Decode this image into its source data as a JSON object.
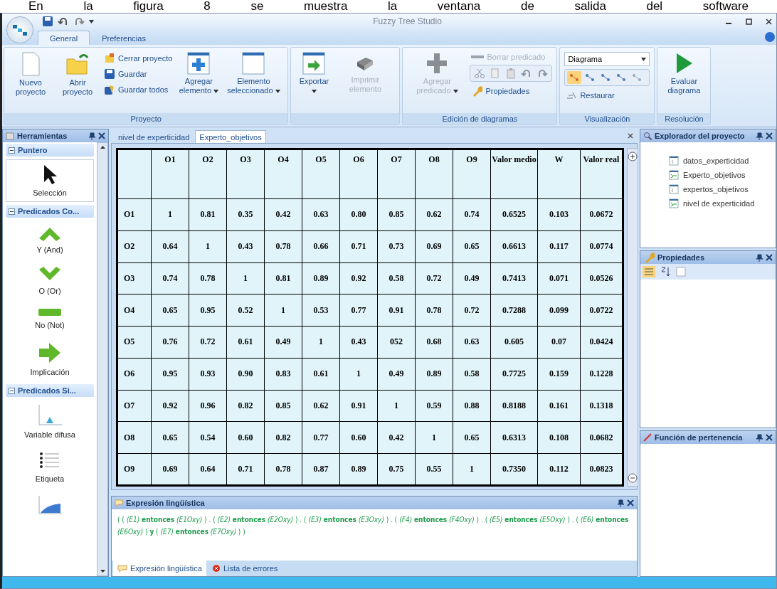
{
  "caption": "En la figura 8 se muestra la ventana de salida del software",
  "window": {
    "title": "Fuzzy Tree Studio"
  },
  "ribbon_tabs": [
    {
      "label": "General",
      "selected": true
    },
    {
      "label": "Preferencias",
      "selected": false
    }
  ],
  "ribbon_groups": [
    {
      "title": "Proyecto",
      "items": [
        {
          "kind": "large",
          "label": "Nuevo proyecto",
          "disabled": false,
          "dropdown": false
        },
        {
          "kind": "large",
          "label": "Abrir proyecto",
          "disabled": false,
          "dropdown": false
        },
        {
          "kind": "stack",
          "items": [
            {
              "label": "Cerrar proyecto",
              "disabled": false
            },
            {
              "label": "Guardar",
              "disabled": false
            },
            {
              "label": "Guardar todos",
              "disabled": false
            }
          ]
        },
        {
          "kind": "large",
          "label": "Agregar elemento",
          "disabled": false,
          "dropdown": true
        },
        {
          "kind": "large",
          "label": "Elemento seleccionado",
          "disabled": false,
          "dropdown": true
        }
      ]
    },
    {
      "items": [
        {
          "kind": "large",
          "label": "Exportar",
          "disabled": false,
          "dropdown": true
        },
        {
          "kind": "large",
          "label": "Imprimir elemento",
          "disabled": true,
          "dropdown": false
        }
      ]
    },
    {
      "title": "Edición de diagramas",
      "items": [
        {
          "kind": "large",
          "label": "Agregar predicado",
          "disabled": true,
          "dropdown": true
        },
        {
          "kind": "stack",
          "items": [
            {
              "label": "Borrar predicado",
              "disabled": true
            },
            {
              "kind": "toolbar"
            },
            {
              "label": "Propiedades",
              "disabled": false
            }
          ]
        }
      ]
    },
    {
      "title": "Visualización",
      "items": [
        {
          "kind": "stack",
          "items": [
            {
              "kind": "select",
              "value": "Diagrama"
            },
            {
              "kind": "gallery",
              "items": [
                {
                  "selected": true
                },
                {
                  "selected": false
                },
                {
                  "selected": false
                },
                {
                  "selected": false
                },
                {
                  "selected": false
                }
              ]
            },
            {
              "label": "Restaurar",
              "disabled": false
            }
          ]
        }
      ]
    },
    {
      "title": "Resolución",
      "items": [
        {
          "kind": "large",
          "label": "Evaluar diagrama",
          "disabled": false,
          "dropdown": false
        }
      ]
    }
  ],
  "toolbox": {
    "title": "Herramientas",
    "sections": [
      {
        "title": "Puntero",
        "items": [
          {
            "label": "Selección",
            "selected": true
          }
        ]
      },
      {
        "title": "Predicados Co...",
        "items": [
          {
            "label": "Y (And)",
            "selected": false
          },
          {
            "label": "O (Or)",
            "selected": false
          },
          {
            "label": "No (Not)",
            "selected": false
          },
          {
            "label": "Implicación",
            "selected": false
          }
        ]
      },
      {
        "title": "Predicados Si...",
        "items": [
          {
            "label": "Variable difusa",
            "selected": false
          },
          {
            "label": "Etiqueta",
            "selected": false
          },
          {
            "selected": false
          }
        ]
      }
    ]
  },
  "document_tabs": [
    {
      "label": "nivel de experticidad",
      "selected": false
    },
    {
      "label": "Experto_objetivos",
      "selected": true
    }
  ],
  "table": {
    "columns": [
      "O1",
      "O2",
      "O3",
      "O4",
      "O5",
      "O6",
      "O7",
      "O8",
      "O9",
      "Valor medio",
      "W",
      "Valor real"
    ],
    "rows": [
      {
        "label": "O1",
        "cells": [
          "1",
          "0.81",
          "0.35",
          "0.42",
          "0.63",
          "0.80",
          "0.85",
          "0.62",
          "0.74",
          "0.6525",
          "0.103",
          "0.0672"
        ]
      },
      {
        "label": "O2",
        "cells": [
          "0.64",
          "1",
          "0.43",
          "0.78",
          "0.66",
          "0.71",
          "0.73",
          "0.69",
          "0.65",
          "0.6613",
          "0.117",
          "0.0774"
        ]
      },
      {
        "label": "O3",
        "cells": [
          "0.74",
          "0.78",
          "1",
          "0.81",
          "0.89",
          "0.92",
          "0.58",
          "0.72",
          "0.49",
          "0.7413",
          "0.071",
          "0.0526"
        ]
      },
      {
        "label": "O4",
        "cells": [
          "0.65",
          "0.95",
          "0.52",
          "1",
          "0.53",
          "0.77",
          "0.91",
          "0.78",
          "0.72",
          "0.7288",
          "0.099",
          "0.0722"
        ]
      },
      {
        "label": "O5",
        "cells": [
          "0.76",
          "0.72",
          "0.61",
          "0.49",
          "1",
          "0.43",
          "052",
          "0.68",
          "0.63",
          "0.605",
          "0.07",
          "0.0424"
        ]
      },
      {
        "label": "O6",
        "cells": [
          "0.95",
          "0.93",
          "0.90",
          "0.83",
          "0.61",
          "1",
          "0.49",
          "0.89",
          "0.58",
          "0.7725",
          "0.159",
          "0.1228"
        ]
      },
      {
        "label": "O7",
        "cells": [
          "0.92",
          "0.96",
          "0.82",
          "0.85",
          "0.62",
          "0.91",
          "1",
          "0.59",
          "0.88",
          "0.8188",
          "0.161",
          "0.1318"
        ]
      },
      {
        "label": "O8",
        "cells": [
          "0.65",
          "0.54",
          "0.60",
          "0.82",
          "0.77",
          "0.60",
          "0.42",
          "1",
          "0.65",
          "0.6313",
          "0.108",
          "0.0682"
        ]
      },
      {
        "label": "O9",
        "cells": [
          "0.69",
          "0.64",
          "0.71",
          "0.78",
          "0.87",
          "0.89",
          "0.75",
          "0.55",
          "1",
          "0.7350",
          "0.112",
          "0.0823"
        ]
      }
    ]
  },
  "expression_panel": {
    "title": "Expresión lingüística",
    "text": "( ( *(E1)* **entonces** *(E1Oxy)* ) . ( *(E2)* **entonces** *(E2Oxy)* ) . ( *(E3)* **entonces** *(E3Oxy)* ) . ( *(F4)* **entonces** *(F4Oxy)* ) . ( *(E5)* **entonces** *(E5Oxy)* ) . ( *(E6)* **entonces** *(E6Oxy)* ) **y** ( *(E7)* **entonces** *(E7Oxy)* ) )"
  },
  "bottom_tabs": [
    {
      "label": "Expresión lingüística",
      "selected": true
    },
    {
      "label": "Lista de errores",
      "selected": false
    }
  ],
  "project_explorer": {
    "title": "Explorador del proyecto",
    "items": [
      {
        "label": "datos_experticidad",
        "kind": "table"
      },
      {
        "label": "Experto_objetivos",
        "kind": "diagram"
      },
      {
        "label": "expertos_objetivos",
        "kind": "table"
      },
      {
        "label": "nivel de experticidad",
        "kind": "diagram"
      }
    ]
  },
  "properties_panel": {
    "title": "Propiedades"
  },
  "membership_panel": {
    "title": "Función de pertenencia"
  }
}
